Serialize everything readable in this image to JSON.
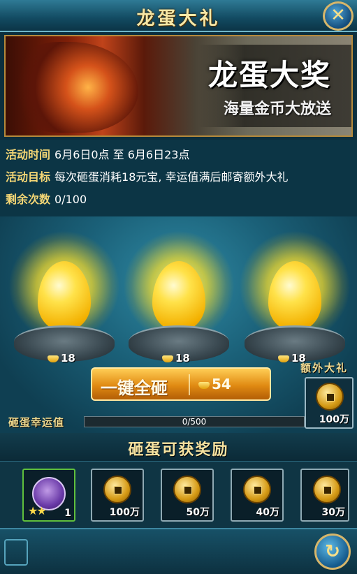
{
  "window": {
    "title": "龙蛋大礼",
    "close_icon": "close-icon"
  },
  "banner": {
    "headline": "龙蛋大奖",
    "subline": "海量金币大放送"
  },
  "info": {
    "time_label": "活动时间",
    "time_value": "6月6日0点  至  6月6日23点",
    "goal_label": "活动目标",
    "goal_value": "每次砸蛋消耗18元宝, 幸运值满后邮寄额外大礼",
    "remaining_label": "剩余次数",
    "remaining_value": "0/100"
  },
  "eggs": [
    {
      "cost": "18",
      "icon": "ingot-icon"
    },
    {
      "cost": "18",
      "icon": "ingot-icon"
    },
    {
      "cost": "18",
      "icon": "ingot-icon"
    }
  ],
  "smash_all": {
    "label": "一键全砸",
    "cost": "54",
    "icon": "ingot-icon"
  },
  "extra_gift": {
    "label": "额外大礼",
    "amount": "100万",
    "icon": "coin-icon"
  },
  "luck": {
    "label": "砸蛋幸运值",
    "value": "0/500",
    "progress": 0
  },
  "rewards": {
    "title": "砸蛋可获奖励",
    "items": [
      {
        "kind": "badge",
        "amount": "1",
        "stars": "★★",
        "icon": "purple-badge-icon"
      },
      {
        "kind": "coin",
        "amount": "100万",
        "icon": "coin-icon"
      },
      {
        "kind": "coin",
        "amount": "50万",
        "icon": "coin-icon"
      },
      {
        "kind": "coin",
        "amount": "40万",
        "icon": "coin-icon"
      },
      {
        "kind": "coin",
        "amount": "30万",
        "icon": "coin-icon"
      }
    ]
  },
  "bottom": {
    "button_icon": "refresh-icon"
  }
}
